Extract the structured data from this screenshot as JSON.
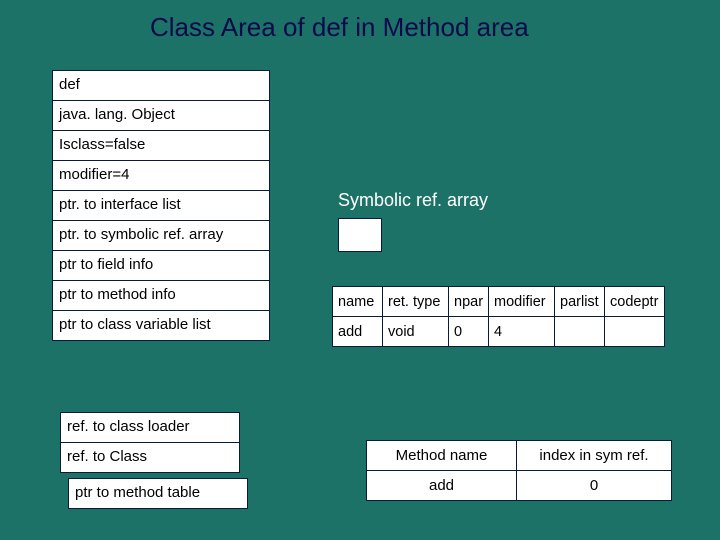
{
  "title": "Class Area of def in Method area",
  "class_area": {
    "rows": [
      "def",
      "java. lang. Object",
      "Isclass=false",
      "modifier=4",
      "ptr. to interface list",
      "ptr. to symbolic ref. array",
      "ptr to field info",
      "ptr to method info",
      "ptr to class variable list"
    ]
  },
  "refs": {
    "rows": [
      "ref. to class loader",
      "ref. to Class"
    ]
  },
  "method_table_ptr": "ptr to method table",
  "symbolic_ref": {
    "label": "Symbolic ref. array"
  },
  "method_table": {
    "headers": [
      "name",
      "ret. type",
      "npar",
      "modifier",
      "parlist",
      "codeptr"
    ],
    "row": {
      "name": "add",
      "ret_type": "void",
      "npar": "0",
      "modifier": "4",
      "parlist": "",
      "codeptr": ""
    }
  },
  "index_table": {
    "headers": [
      "Method name",
      "index in sym ref."
    ],
    "row": {
      "name": "add",
      "index": "0"
    }
  }
}
